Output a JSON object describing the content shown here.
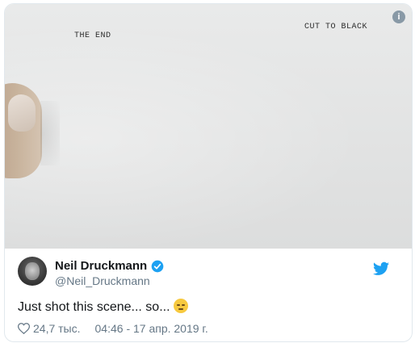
{
  "media": {
    "typed_left": "THE END",
    "typed_right": "CUT TO BLACK",
    "info_symbol": "i",
    "info_icon": "info-icon"
  },
  "author": {
    "name": "Neil Druckmann",
    "handle": "@Neil_Druckmann",
    "verified_icon": "verified-badge-icon",
    "brand_icon": "twitter-bird-icon",
    "brand_color": "#1da1f2"
  },
  "tweet": {
    "text": "Just shot this scene... so...",
    "emoji_icon": "pensive-face-emoji"
  },
  "meta": {
    "heart_icon": "heart-icon",
    "likes": "24,7 тыс.",
    "timestamp": "04:46 - 17 апр. 2019 г."
  }
}
